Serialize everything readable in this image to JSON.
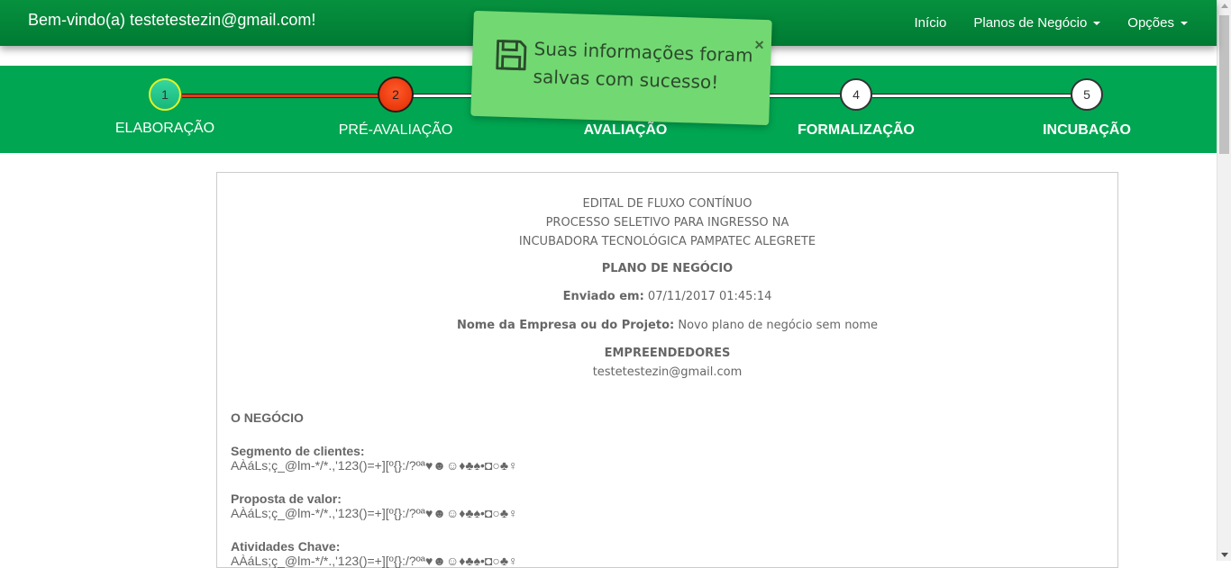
{
  "navbar": {
    "welcome": "Bem-vindo(a) testetestezin@gmail.com!",
    "items": [
      {
        "label": "Início",
        "dropdown": false
      },
      {
        "label": "Planos de Negócio",
        "dropdown": true
      },
      {
        "label": "Opções",
        "dropdown": true
      }
    ]
  },
  "stepper": {
    "steps": [
      {
        "number": "1",
        "label": "ELABORAÇÃO",
        "status": "done"
      },
      {
        "number": "2",
        "label": "PRÉ-AVALIAÇÃO",
        "status": "current"
      },
      {
        "number": "3",
        "label": "AVALIAÇÃO",
        "status": "pending"
      },
      {
        "number": "4",
        "label": "FORMALIZAÇÃO",
        "status": "pending"
      },
      {
        "number": "5",
        "label": "INCUBAÇÃO",
        "status": "pending"
      }
    ]
  },
  "toast": {
    "line1": "Suas informações foram",
    "line2": "salvas com sucesso!",
    "close": "×",
    "icon": "floppy-disk-icon"
  },
  "document": {
    "edital_line1": "EDITAL DE FLUXO CONTÍNUO",
    "edital_line2": "PROCESSO SELETIVO PARA INGRESSO NA",
    "edital_line3": "INCUBADORA TECNOLÓGICA PAMPATEC ALEGRETE",
    "plano_title": "PLANO DE NEGÓCIO",
    "enviado_label": "Enviado em:",
    "enviado_value": "07/11/2017 01:45:14",
    "empresa_label": "Nome da Empresa ou do Projeto:",
    "empresa_value": "Novo plano de negócio sem nome",
    "empreendedores_title": "EMPREENDEDORES",
    "empreendedor_email": "testetestezin@gmail.com",
    "section_title": "O NEGÓCIO",
    "fields": [
      {
        "label": "Segmento de clientes:",
        "value": "AÀáLs;ç_@lm-*/*.,'123()=+][º{}:/?ºª♥☻☺♦♣♠•◘○♣♀"
      },
      {
        "label": "Proposta de valor:",
        "value": "AÀáLs;ç_@lm-*/*.,'123()=+][º{}:/?ºª♥☻☺♦♣♠•◘○♣♀"
      },
      {
        "label": "Atividades Chave:",
        "value": "AÀáLs;ç_@lm-*/*.,'123()=+][º{}:/?ºª♥☻☺♦♣♠•◘○♣♀"
      }
    ]
  },
  "colors": {
    "navbar": "#007a33",
    "stepper_bg": "#00a651",
    "toast_bg": "#72d872",
    "progress_done": "#e53b12"
  }
}
